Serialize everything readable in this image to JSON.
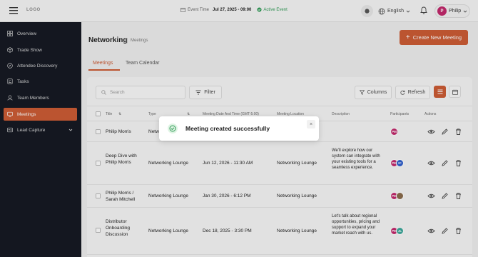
{
  "header": {
    "logo": "LOGO",
    "event_time_label": "Event Time",
    "event_date": "Jul 27, 2025 - 09:00",
    "event_status": "Active Event",
    "language": "English",
    "user_name": "Philip",
    "user_initial": "P"
  },
  "sidebar": {
    "items": [
      {
        "label": "Overview",
        "icon": "grid-icon"
      },
      {
        "label": "Trade Show",
        "icon": "cube-icon"
      },
      {
        "label": "Attendee Discovery",
        "icon": "compass-icon"
      },
      {
        "label": "Tasks",
        "icon": "checklist-icon"
      },
      {
        "label": "Team Members",
        "icon": "user-icon"
      },
      {
        "label": "Meetings",
        "icon": "meeting-icon"
      },
      {
        "label": "Lead Capture",
        "icon": "id-card-icon"
      }
    ]
  },
  "page": {
    "title": "Networking",
    "breadcrumb": "Meetings",
    "create_button": "Create New Meeting",
    "tabs": [
      "Meetings",
      "Team Calendar"
    ]
  },
  "toolbar": {
    "search_placeholder": "Search",
    "filter": "Filter",
    "columns": "Columns",
    "refresh": "Refresh"
  },
  "table": {
    "headers": [
      "Title",
      "Type",
      "Meeting Date And Time (GMT-5:00)",
      "Meeting Location",
      "Description",
      "Participants",
      "Actions"
    ],
    "rows": [
      {
        "title": "Philip Morris",
        "type": "Network",
        "date": "",
        "location": "",
        "description": "",
        "participants": [
          "PM"
        ]
      },
      {
        "title": "Deep Dive with Philip Morris",
        "type": "Networking Lounge",
        "date": "Jun 12, 2026 - 11:30 AM",
        "location": "Networking Lounge",
        "description": "We'll explore how our system can integrate with your existing tools for a seamless experience.",
        "participants": [
          "PM",
          "IC"
        ]
      },
      {
        "title": "Philip Morris / Sarah Mitchell",
        "type": "Networking Lounge",
        "date": "Jan 30, 2026 - 6:12 PM",
        "location": "Networking Lounge",
        "description": "",
        "participants": [
          "PM",
          "SM"
        ]
      },
      {
        "title": "Distributor Onboarding Discussion",
        "type": "Networking Lounge",
        "date": "Dec 18, 2025 - 3:30 PM",
        "location": "Networking Lounge",
        "description": "Let's talk about regional opportunities, pricing and support to expand your market reach with us.",
        "participants": [
          "PM",
          "JL"
        ]
      }
    ]
  },
  "toast": {
    "message": "Meeting created successfully",
    "close": "×"
  },
  "colors": {
    "accent": "#cc5a32",
    "sidebar_bg": "#121620",
    "success": "#2e9a55"
  }
}
